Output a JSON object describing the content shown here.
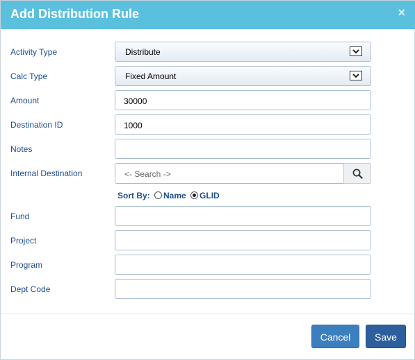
{
  "dialog": {
    "title": "Add Distribution Rule",
    "close_glyph": "×"
  },
  "form": {
    "activity_type": {
      "label": "Activity Type",
      "value": "Distribute"
    },
    "calc_type": {
      "label": "Calc Type",
      "value": "Fixed Amount"
    },
    "amount": {
      "label": "Amount",
      "value": "30000"
    },
    "destination_id": {
      "label": "Destination ID",
      "value": "1000"
    },
    "notes": {
      "label": "Notes",
      "value": ""
    },
    "internal_destination": {
      "label": "Internal Destination",
      "placeholder": "<- Search ->"
    },
    "sort_by": {
      "label": "Sort By:",
      "options": [
        "Name",
        "GLID"
      ],
      "selected": "GLID"
    },
    "fund": {
      "label": "Fund",
      "value": ""
    },
    "project": {
      "label": "Project",
      "value": ""
    },
    "program": {
      "label": "Program",
      "value": ""
    },
    "dept_code": {
      "label": "Dept Code",
      "value": ""
    }
  },
  "footer": {
    "cancel_label": "Cancel",
    "save_label": "Save"
  },
  "colors": {
    "header_bg": "#5bc0de",
    "label_text": "#1f4e8c",
    "cancel_bg": "#3c7fbf",
    "save_bg": "#2d5f9e"
  },
  "icons": {
    "close": "close-icon",
    "dropdown": "chevron-down-icon",
    "search": "search-icon"
  }
}
